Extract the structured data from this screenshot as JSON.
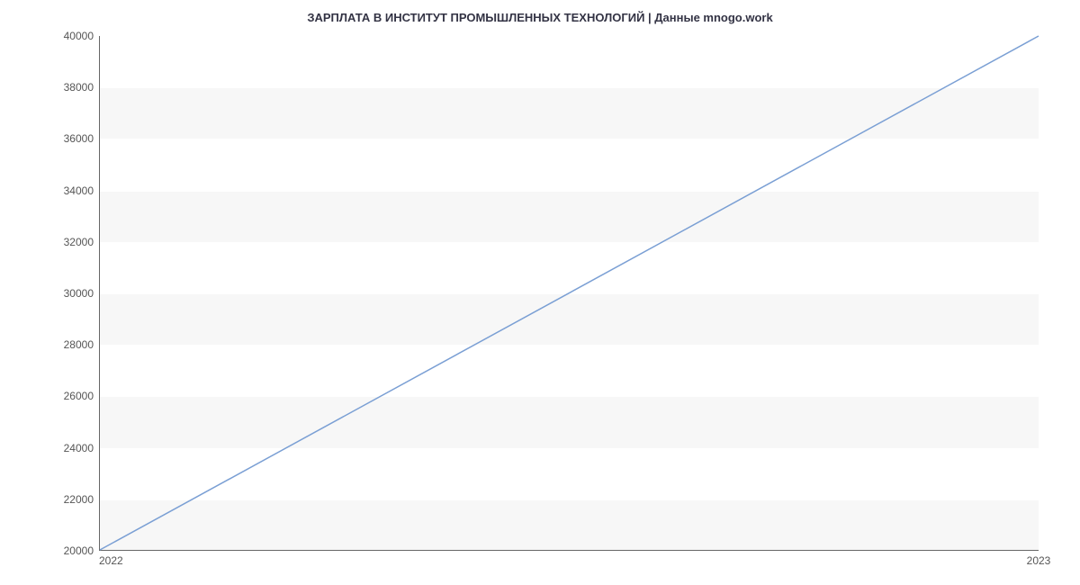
{
  "chart_data": {
    "type": "line",
    "title": "ЗАРПЛАТА В  ИНСТИТУТ ПРОМЫШЛЕННЫХ ТЕХНОЛОГИЙ  | Данные mnogo.work",
    "xlabel": "",
    "ylabel": "",
    "x": [
      "2022",
      "2023"
    ],
    "values": [
      20000,
      40000
    ],
    "ylim": [
      20000,
      40000
    ],
    "yticks": [
      20000,
      22000,
      24000,
      26000,
      28000,
      30000,
      32000,
      34000,
      36000,
      38000,
      40000
    ],
    "line_color": "#7a9fd4"
  }
}
